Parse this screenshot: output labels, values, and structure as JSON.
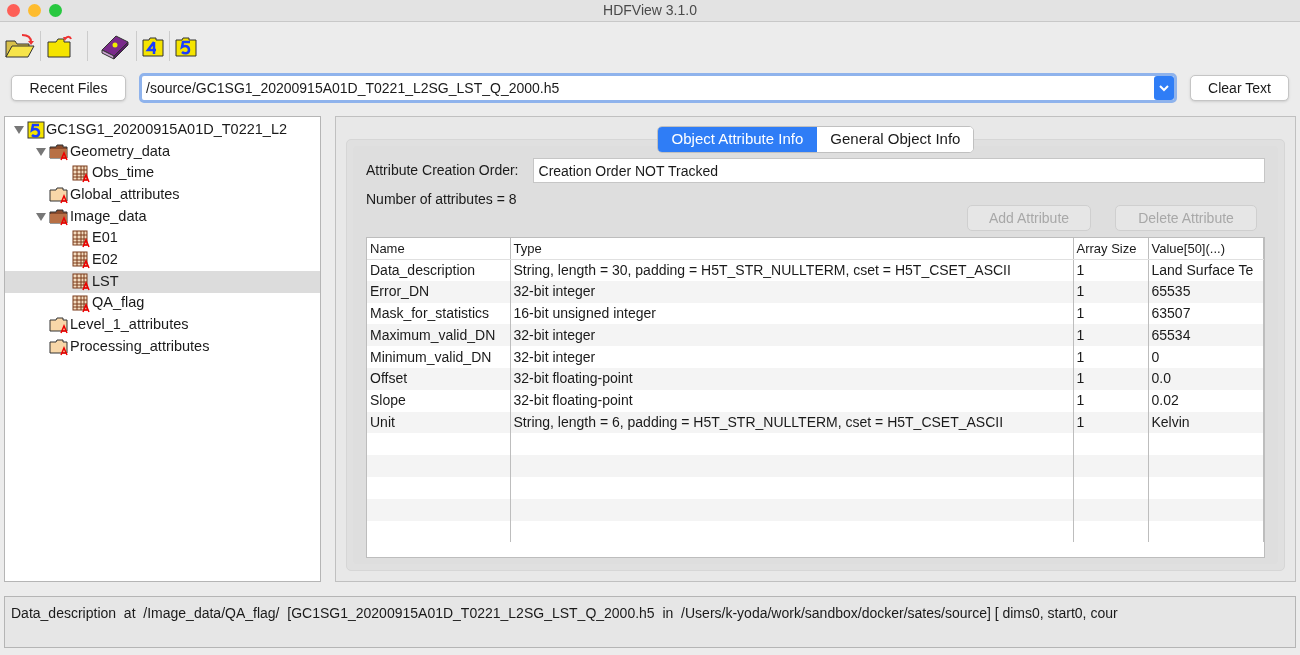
{
  "window": {
    "title": "HDFView 3.1.0"
  },
  "toolbar": {
    "recent_button": "Recent Files",
    "file_path": "/source/GC1SG1_20200915A01D_T0221_L2SG_LST_Q_2000.h5",
    "clear_button": "Clear Text"
  },
  "tree": [
    {
      "label": "GC1SG1_20200915A01D_T0221_L2",
      "kind": "file",
      "expanded": true,
      "selected": false,
      "children": [
        {
          "label": "Geometry_data",
          "kind": "group",
          "expanded": true,
          "selected": false,
          "children": [
            {
              "label": "Obs_time",
              "kind": "dataset",
              "selected": false
            }
          ]
        },
        {
          "label": "Global_attributes",
          "kind": "group",
          "expanded": false,
          "selected": false
        },
        {
          "label": "Image_data",
          "kind": "group",
          "expanded": true,
          "selected": false,
          "children": [
            {
              "label": "E01",
              "kind": "dataset",
              "selected": false
            },
            {
              "label": "E02",
              "kind": "dataset",
              "selected": false
            },
            {
              "label": "LST",
              "kind": "dataset",
              "selected": true
            },
            {
              "label": "QA_flag",
              "kind": "dataset",
              "selected": false
            }
          ]
        },
        {
          "label": "Level_1_attributes",
          "kind": "group",
          "expanded": false,
          "selected": false
        },
        {
          "label": "Processing_attributes",
          "kind": "group",
          "expanded": false,
          "selected": false
        }
      ]
    }
  ],
  "tabs": [
    {
      "label": "Object Attribute Info",
      "selected": true
    },
    {
      "label": "General Object Info",
      "selected": false
    }
  ],
  "attributes": {
    "creation_order_label": "Attribute Creation Order:",
    "creation_order_value": "Creation Order NOT Tracked",
    "count": "Number of attributes = 8",
    "add_button": {
      "label": "Add Attribute",
      "disabled": true
    },
    "delete_button": {
      "label": "Delete Attribute",
      "disabled": true
    }
  },
  "table": {
    "columns": [
      "Name",
      "Type",
      "Array Size",
      "Value[50](...)"
    ],
    "rows": [
      [
        "Data_description",
        "String, length = 30, padding = H5T_STR_NULLTERM, cset = H5T_CSET_ASCII",
        "1",
        "Land Surface Te"
      ],
      [
        "Error_DN",
        "32-bit integer",
        "1",
        "65535"
      ],
      [
        "Mask_for_statistics",
        "16-bit unsigned integer",
        "1",
        "63507"
      ],
      [
        "Maximum_valid_DN",
        "32-bit integer",
        "1",
        "65534"
      ],
      [
        "Minimum_valid_DN",
        "32-bit integer",
        "1",
        "0"
      ],
      [
        "Offset",
        "32-bit floating-point",
        "1",
        "0.0"
      ],
      [
        "Slope",
        "32-bit floating-point",
        "1",
        "0.02"
      ],
      [
        "Unit",
        "String, length = 6, padding = H5T_STR_NULLTERM, cset = H5T_CSET_ASCII",
        "1",
        "Kelvin"
      ]
    ]
  },
  "status_bar": "Data_description  at  /Image_data/QA_flag/  [GC1SG1_20200915A01D_T0221_L2SG_LST_Q_2000.h5  in  /Users/k-yoda/work/sandbox/docker/sates/source] [ dims0, start0, cour"
}
